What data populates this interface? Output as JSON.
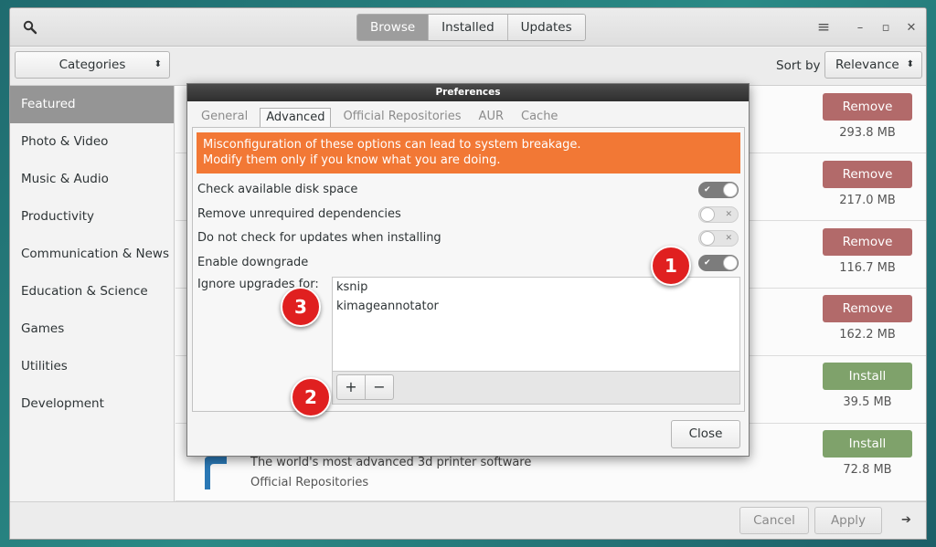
{
  "header": {
    "tabs": [
      {
        "label": "Browse",
        "active": true
      },
      {
        "label": "Installed",
        "active": false
      },
      {
        "label": "Updates",
        "active": false
      }
    ],
    "icons": [
      "search-icon",
      "menu-icon",
      "minimize-icon",
      "maximize-icon",
      "close-icon"
    ],
    "menu_glyph": "≡",
    "minimize_glyph": "–",
    "maximize_glyph": "▫",
    "close_glyph": "✕"
  },
  "toolbar": {
    "categories_label": "Categories",
    "sort_label": "Sort by",
    "sort_value": "Relevance",
    "dropdown_arrow": "⬍"
  },
  "sidebar": {
    "items": [
      {
        "label": "Featured",
        "active": true
      },
      {
        "label": "Photo & Video"
      },
      {
        "label": "Music & Audio"
      },
      {
        "label": "Productivity"
      },
      {
        "label": "Communication & News"
      },
      {
        "label": "Education & Science"
      },
      {
        "label": "Games"
      },
      {
        "label": "Utilities"
      },
      {
        "label": "Development"
      }
    ]
  },
  "packages": [
    {
      "action": "Remove",
      "size": "293.8 MB"
    },
    {
      "action": "Remove",
      "size": "217.0 MB"
    },
    {
      "action": "Remove",
      "size": "116.7 MB"
    },
    {
      "action": "Remove",
      "size": "162.2 MB"
    },
    {
      "action": "Install",
      "size": "39.5 MB"
    },
    {
      "action": "Install",
      "size": "72.8 MB",
      "description": "The world's most advanced 3d printer software",
      "repo": "Official Repositories"
    }
  ],
  "bottom": {
    "cancel_label": "Cancel",
    "apply_label": "Apply",
    "arrow_glyph": "➔"
  },
  "dialog": {
    "title": "Preferences",
    "tabs": [
      {
        "label": "General",
        "active": false
      },
      {
        "label": "Advanced",
        "active": true
      },
      {
        "label": "Official Repositories",
        "active": false
      },
      {
        "label": "AUR",
        "active": false
      },
      {
        "label": "Cache",
        "active": false
      }
    ],
    "warning_line1": "Misconfiguration of these options can lead to system breakage.",
    "warning_line2": "Modify them only if you know what you are doing.",
    "options": [
      {
        "label": "Check available disk space",
        "enabled": true
      },
      {
        "label": "Remove unrequired dependencies",
        "enabled": false
      },
      {
        "label": "Do not check for updates when installing",
        "enabled": false
      },
      {
        "label": "Enable downgrade",
        "enabled": true
      }
    ],
    "switch_on_mark": "✔",
    "switch_off_mark": "✕",
    "ignore_label": "Ignore upgrades for:",
    "ignore_list": [
      "ksnip",
      "kimageannotator"
    ],
    "add_glyph": "+",
    "remove_glyph": "−",
    "close_label": "Close"
  },
  "markers": [
    "1",
    "2",
    "3"
  ],
  "colors": {
    "warning": "#f27835",
    "remove": "#b26a6a",
    "install": "#7fa26b",
    "marker": "#e02020"
  }
}
